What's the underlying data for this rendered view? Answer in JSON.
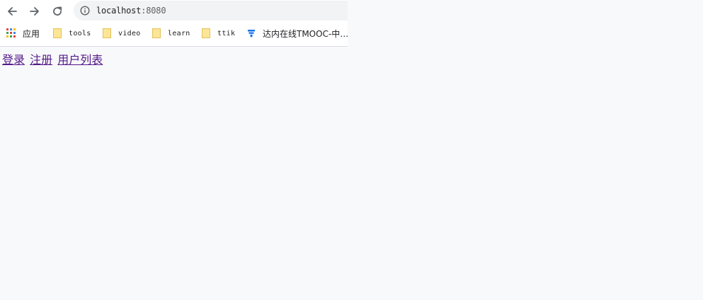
{
  "browser": {
    "url_host": "localhost",
    "url_port": ":8080",
    "bookmarks": [
      {
        "label": "应用",
        "icon": "apps-grid-icon"
      },
      {
        "label": "tools",
        "icon": "folder-icon"
      },
      {
        "label": "video",
        "icon": "folder-icon"
      },
      {
        "label": "learn",
        "icon": "folder-icon"
      },
      {
        "label": "ttik",
        "icon": "folder-icon"
      },
      {
        "label": "达内在线TMOOC-中…",
        "icon": "tmooc-logo-icon"
      }
    ]
  },
  "page": {
    "links": [
      {
        "label": "登录"
      },
      {
        "label": "注册"
      },
      {
        "label": "用户列表"
      }
    ]
  },
  "colors": {
    "page_background": "#f8f9fa",
    "visited_link": "#551a8b",
    "omnibox": "#f1f3f4",
    "folder": "#fce596"
  }
}
